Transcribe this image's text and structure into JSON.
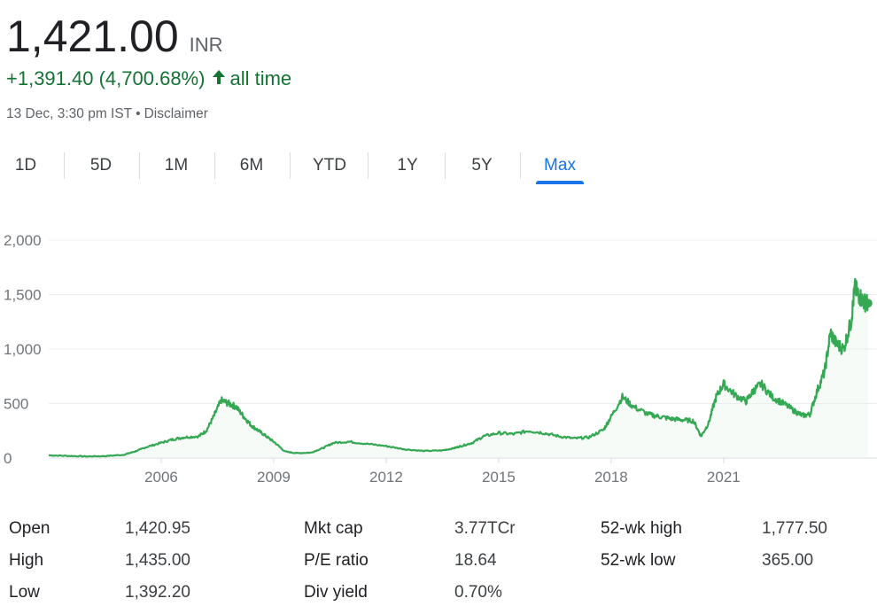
{
  "quote": {
    "price": "1,421.00",
    "currency": "INR",
    "change": "+1,391.40 (4,700.68%)",
    "period": "all time",
    "timestamp": "13 Dec, 3:30 pm IST",
    "disclaimer": "Disclaimer",
    "up_color": "#137333"
  },
  "tabs": [
    {
      "label": "1D",
      "active": false
    },
    {
      "label": "5D",
      "active": false
    },
    {
      "label": "1M",
      "active": false
    },
    {
      "label": "6M",
      "active": false
    },
    {
      "label": "YTD",
      "active": false
    },
    {
      "label": "1Y",
      "active": false
    },
    {
      "label": "5Y",
      "active": false
    },
    {
      "label": "Max",
      "active": true
    }
  ],
  "chart_data": {
    "type": "line",
    "line_color": "#34a853",
    "grid": true,
    "ylim": [
      0,
      2000
    ],
    "yticks": [
      {
        "value": 0,
        "label": "0"
      },
      {
        "value": 500,
        "label": "500"
      },
      {
        "value": 1000,
        "label": "1,000"
      },
      {
        "value": 1500,
        "label": "1,500"
      },
      {
        "value": 2000,
        "label": "2,000"
      }
    ],
    "xlim": [
      2003.0,
      2024.95
    ],
    "xticks": [
      {
        "value": 2006,
        "label": "2006"
      },
      {
        "value": 2009,
        "label": "2009"
      },
      {
        "value": 2012,
        "label": "2012"
      },
      {
        "value": 2015,
        "label": "2015"
      },
      {
        "value": 2018,
        "label": "2018"
      },
      {
        "value": 2021,
        "label": "2021"
      }
    ],
    "series": [
      {
        "x": [
          2003.0,
          2003.5,
          2004.0,
          2004.5,
          2005.0,
          2005.3,
          2005.6,
          2006.0,
          2006.3,
          2006.6,
          2007.0,
          2007.2,
          2007.4,
          2007.6,
          2007.8,
          2008.0,
          2008.2,
          2008.4,
          2008.6,
          2008.8,
          2009.0,
          2009.3,
          2009.6,
          2010.0,
          2010.3,
          2010.6,
          2011.0,
          2011.5,
          2012.0,
          2012.5,
          2013.0,
          2013.5,
          2013.8,
          2014.0,
          2014.3,
          2014.6,
          2015.0,
          2015.4,
          2015.8,
          2016.2,
          2016.6,
          2017.0,
          2017.4,
          2017.8,
          2018.0,
          2018.3,
          2018.6,
          2019.0,
          2019.3,
          2019.6,
          2019.9,
          2020.2,
          2020.4,
          2020.6,
          2020.8,
          2021.0,
          2021.3,
          2021.6,
          2021.8,
          2022.0,
          2022.3,
          2022.6,
          2022.9,
          2023.1,
          2023.3,
          2023.5,
          2023.7,
          2023.85,
          2024.0,
          2024.2,
          2024.4,
          2024.5,
          2024.6,
          2024.75,
          2024.85
        ],
        "y": [
          25,
          20,
          15,
          18,
          30,
          60,
          100,
          140,
          170,
          190,
          200,
          250,
          380,
          530,
          500,
          470,
          380,
          300,
          250,
          200,
          150,
          60,
          45,
          50,
          90,
          140,
          150,
          130,
          110,
          80,
          65,
          70,
          90,
          110,
          140,
          200,
          230,
          220,
          250,
          230,
          200,
          180,
          190,
          260,
          380,
          560,
          470,
          400,
          380,
          360,
          350,
          340,
          200,
          320,
          560,
          680,
          580,
          520,
          620,
          680,
          560,
          500,
          430,
          390,
          400,
          620,
          800,
          1150,
          1050,
          1000,
          1250,
          1560,
          1500,
          1430,
          1421
        ]
      }
    ],
    "last_point": {
      "x": 2024.85,
      "y": 1421
    }
  },
  "stats": [
    {
      "label": "Open",
      "value": "1,420.95"
    },
    {
      "label": "High",
      "value": "1,435.00"
    },
    {
      "label": "Low",
      "value": "1,392.20"
    },
    {
      "label": "Mkt cap",
      "value": "3.77TCr"
    },
    {
      "label": "P/E ratio",
      "value": "18.64"
    },
    {
      "label": "Div yield",
      "value": "0.70%"
    },
    {
      "label": "52-wk high",
      "value": "1,777.50"
    },
    {
      "label": "52-wk low",
      "value": "365.00"
    }
  ]
}
